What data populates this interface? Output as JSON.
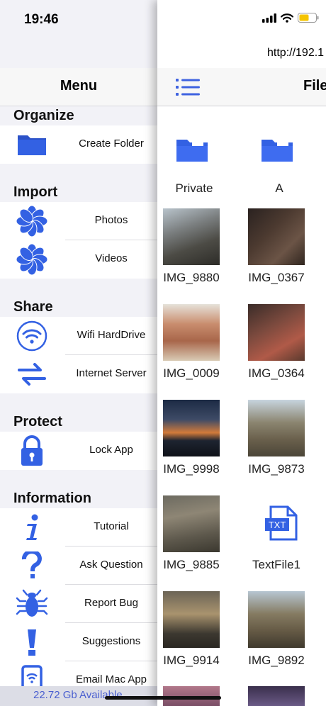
{
  "status": {
    "time": "19:46"
  },
  "menu": {
    "title": "Menu",
    "sections": {
      "organize": {
        "title": "Organize",
        "items": [
          {
            "label": "Create Folder",
            "icon": "folder-icon"
          }
        ]
      },
      "import": {
        "title": "Import",
        "items": [
          {
            "label": "Photos",
            "icon": "photos-flower-icon"
          },
          {
            "label": "Videos",
            "icon": "photos-flower-icon"
          }
        ]
      },
      "share": {
        "title": "Share",
        "items": [
          {
            "label": "Wifi HardDrive",
            "icon": "wifi-icon"
          },
          {
            "label": "Internet Server",
            "icon": "transfer-arrows-icon"
          }
        ]
      },
      "protect": {
        "title": "Protect",
        "items": [
          {
            "label": "Lock App",
            "icon": "lock-icon"
          }
        ]
      },
      "information": {
        "title": "Information",
        "items": [
          {
            "label": "Tutorial",
            "icon": "info-icon"
          },
          {
            "label": "Ask Question",
            "icon": "question-icon"
          },
          {
            "label": "Report Bug",
            "icon": "bug-icon"
          },
          {
            "label": "Suggestions",
            "icon": "exclamation-icon"
          },
          {
            "label": "Email Mac App",
            "icon": "phone-wifi-icon"
          }
        ]
      }
    },
    "storage": "22.72 Gb Available"
  },
  "files": {
    "url": "http://192.1",
    "title": "File",
    "items": [
      {
        "name": "Private",
        "kind": "folder"
      },
      {
        "name": "A",
        "kind": "folder"
      },
      {
        "name": "IMG_9880",
        "kind": "image"
      },
      {
        "name": "IMG_0367",
        "kind": "image"
      },
      {
        "name": "IMG_0009",
        "kind": "image"
      },
      {
        "name": "IMG_0364",
        "kind": "image"
      },
      {
        "name": "IMG_9998",
        "kind": "image"
      },
      {
        "name": "IMG_9873",
        "kind": "image"
      },
      {
        "name": "IMG_9885",
        "kind": "image"
      },
      {
        "name": "TextFile1",
        "kind": "text"
      },
      {
        "name": "IMG_9914",
        "kind": "image"
      },
      {
        "name": "IMG_9892",
        "kind": "image"
      }
    ],
    "txt_badge": "TXT"
  },
  "colors": {
    "accent": "#3f63e0",
    "icon_blue": "#3361e3",
    "storage_text": "#4a5fd0"
  }
}
